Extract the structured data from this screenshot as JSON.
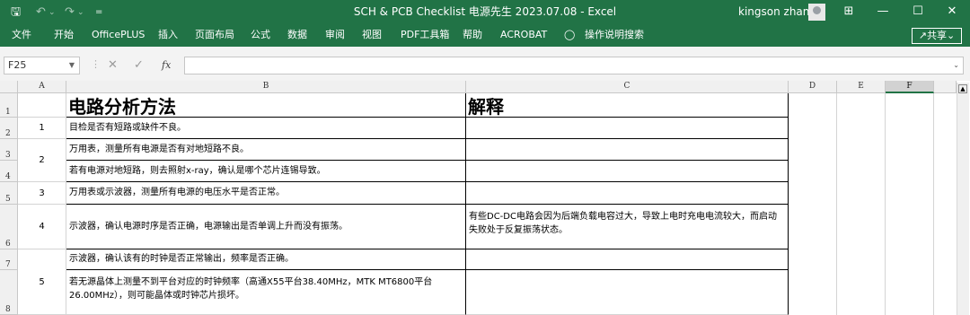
{
  "window": {
    "title": "SCH & PCB Checklist 电源先生 2023.07.08  -  Excel",
    "user": "kingson zhang",
    "qa": {
      "save": "🖫",
      "undo": "↶",
      "undo_dd": "⌄",
      "redo": "↷",
      "redo_dd": "⌄",
      "customize": "="
    },
    "controls": {
      "ribbon_display": "⊞",
      "minimize": "—",
      "maximize": "☐",
      "close": "✕"
    }
  },
  "ribbon": {
    "tabs": [
      "文件",
      "开始",
      "OfficePLUS",
      "插入",
      "页面布局",
      "公式",
      "数据",
      "审阅",
      "视图",
      "PDF工具箱",
      "帮助",
      "ACROBAT"
    ],
    "tellme": "操作说明搜索",
    "share": "共享"
  },
  "formula_bar": {
    "name_box": "F25",
    "fx": "fx",
    "cancel": "✕",
    "enter": "✓",
    "content": ""
  },
  "columns": [
    "A",
    "B",
    "C",
    "D",
    "E",
    "F"
  ],
  "rows": [
    "1",
    "2",
    "3",
    "4",
    "5",
    "6",
    "7",
    "8"
  ],
  "sheet": {
    "header_b": "电路分析方法",
    "header_c": "解释",
    "n1": "1",
    "n2": "2",
    "n3": "3",
    "n4": "4",
    "n5": "5",
    "b2": "目检是否有短路或缺件不良。",
    "b3": "万用表，测量所有电源是否有对地短路不良。",
    "b4": "若有电源对地短路，则去照射x-ray，确认是哪个芯片连锡导致。",
    "b5": "万用表或示波器，测量所有电源的电压水平是否正常。",
    "b6": "示波器，确认电源时序是否正确，电源输出是否单调上升而没有振荡。",
    "c6": "有些DC-DC电路会因为后端负载电容过大，导致上电时充电电流较大，而启动失败处于反复振荡状态。",
    "b7": "示波器，确认该有的时钟是否正常输出，频率是否正确。",
    "b8": "若无源晶体上测量不到平台对应的时钟频率（高通X55平台38.40MHz，MTK MT6800平台26.00MHz），则可能晶体或时钟芯片损坏。"
  }
}
